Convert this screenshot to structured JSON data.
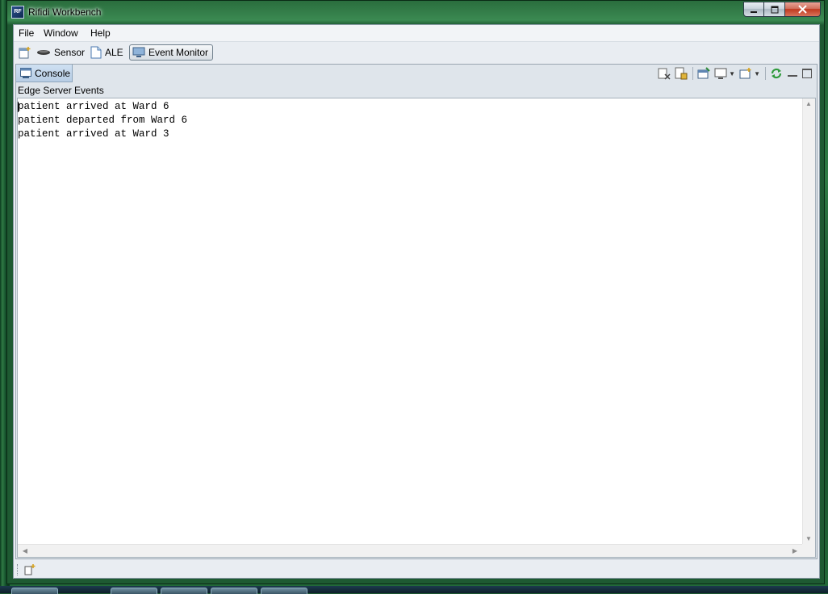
{
  "window": {
    "title": "Rifidi Workbench",
    "controls": {
      "minimize": "minimize",
      "maximize": "maximize",
      "close": "close"
    }
  },
  "menu": {
    "items": [
      {
        "label": "File"
      },
      {
        "label": "Window"
      },
      {
        "label": "Help"
      }
    ]
  },
  "perspectives": {
    "items": [
      {
        "label": "Sensor",
        "icon": "sensor-icon"
      },
      {
        "label": "ALE",
        "icon": "document-icon"
      },
      {
        "label": "Event Monitor",
        "icon": "monitor-icon",
        "active": true
      }
    ]
  },
  "view": {
    "tab_label": "Console",
    "console_name": "Edge Server Events",
    "toolbar_icons": [
      "clear-console-icon",
      "scroll-lock-icon",
      "pin-console-icon",
      "display-console-icon",
      "open-console-icon",
      "refresh-icon",
      "minimize-view-icon",
      "maximize-view-icon"
    ]
  },
  "console": {
    "lines": [
      "patient arrived at Ward 6",
      "patient departed from Ward 6",
      "patient arrived at Ward 3"
    ]
  },
  "colors": {
    "desktop": "#1f5a33",
    "client": "#e9edf2",
    "tab_active": "#cfe0f2"
  }
}
